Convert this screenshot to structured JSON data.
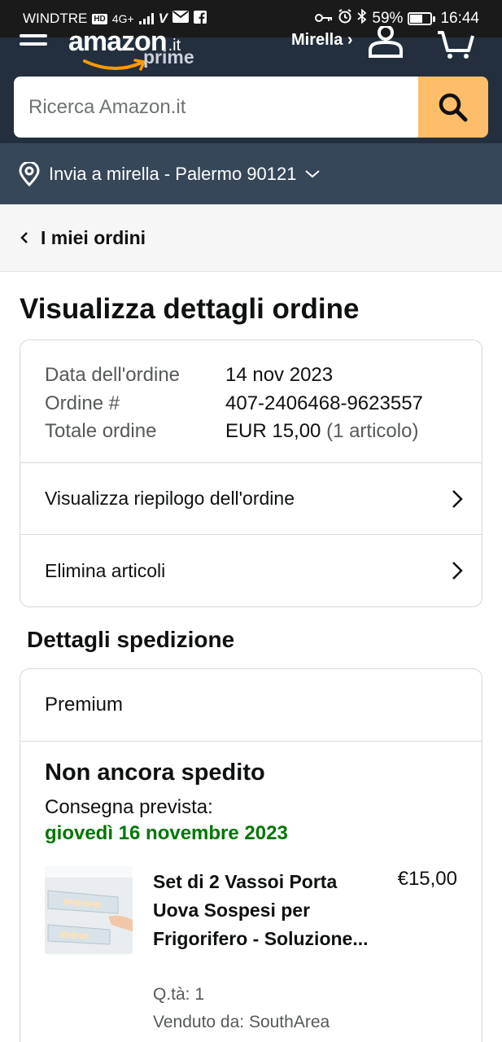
{
  "status_bar": {
    "carrier": "WINDTRE",
    "hd_badge": "HD",
    "network": "4G+",
    "battery": "59%",
    "battery_level": 0.59,
    "time": "16:44"
  },
  "header": {
    "logo_word": "amazon",
    "logo_tld": ".it",
    "logo_prime": "prime",
    "account_label": "Mirella ›",
    "search_placeholder": "Ricerca Amazon.it",
    "deliver_to": "Invia a mirella - Palermo 90121",
    "colors": {
      "header_bg": "#232f3e",
      "deliver_bg": "#37475a",
      "search_button": "#febd69"
    }
  },
  "nav": {
    "back_label": "I miei ordini"
  },
  "page_title": "Visualizza dettagli ordine",
  "order": {
    "rows": [
      {
        "label": "Data dell'ordine",
        "value": "14 nov 2023"
      },
      {
        "label": "Ordine #",
        "value": "407-2406468-9623557"
      }
    ],
    "total_label": "Totale ordine",
    "total_value": "EUR 15,00",
    "total_count": "(1 articolo)",
    "links": [
      {
        "label": "Visualizza riepilogo dell'ordine"
      },
      {
        "label": "Elimina articoli"
      }
    ]
  },
  "shipping": {
    "section_title": "Dettagli spedizione",
    "type": "Premium",
    "status": "Non ancora spedito",
    "delivery_label": "Consegna prevista:",
    "delivery_date": "giovedì 16 novembre 2023",
    "item": {
      "title": "Set di 2 Vassoi Porta Uova Sospesi per Frigorifero - Soluzione...",
      "price": "€15,00",
      "qty": "Q.tà: 1",
      "seller": "Venduto da: SouthArea"
    }
  }
}
